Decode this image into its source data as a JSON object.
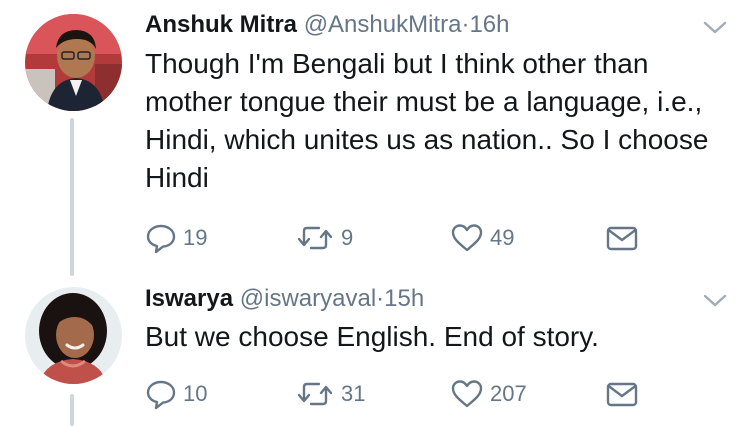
{
  "tweets": [
    {
      "name": "Anshuk Mitra",
      "handle": "@AnshukMitra",
      "separator": "·",
      "time": "16h",
      "text": "Though I'm Bengali but I think other than mother tongue their must be a language, i.e., Hindi, which unites us as nation.. So I choose Hindi",
      "replies": "19",
      "retweets": "9",
      "likes": "49"
    },
    {
      "name": "Iswarya",
      "handle": "@iswaryaval",
      "separator": "·",
      "time": "15h",
      "text": "But we choose English. End of story.",
      "replies": "10",
      "retweets": "31",
      "likes": "207"
    }
  ],
  "icons": {
    "reply": "reply-icon",
    "retweet": "retweet-icon",
    "like": "heart-icon",
    "dm": "envelope-icon",
    "more": "chevron-down-icon"
  },
  "colors": {
    "text": "#14171a",
    "secondary": "#657786",
    "thread_line": "#ccd6dd"
  }
}
